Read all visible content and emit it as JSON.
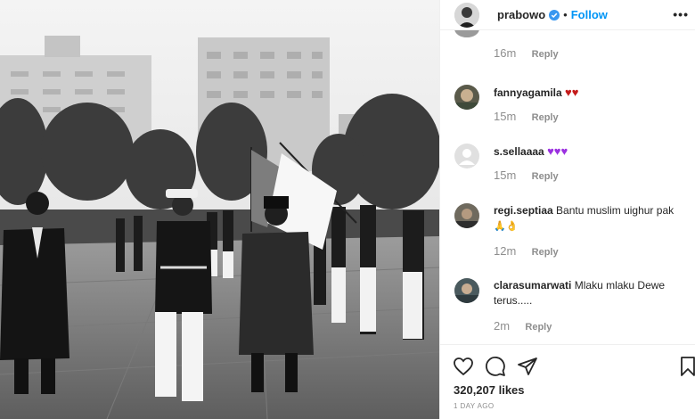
{
  "header": {
    "username": "prabowo",
    "separator": "•",
    "follow_label": "Follow",
    "more_label": "•••"
  },
  "comments": [
    {
      "username": "",
      "text": "",
      "time": "16m",
      "reply_label": "Reply",
      "avatar_icon": "avatar-photo"
    },
    {
      "username": "fannyagamila",
      "text": "",
      "emoji": "♥♥",
      "time": "15m",
      "reply_label": "Reply",
      "avatar_icon": "avatar-photo"
    },
    {
      "username": "s.sellaaaa",
      "text": "",
      "emoji": "♥♥♥",
      "time": "15m",
      "reply_label": "Reply",
      "avatar_icon": "default-avatar-icon"
    },
    {
      "username": "regi.septiaa",
      "text": "Bantu muslim uighur pak",
      "emoji": "🙏👌",
      "time": "12m",
      "reply_label": "Reply",
      "avatar_icon": "avatar-photo"
    },
    {
      "username": "clarasumarwati",
      "text": "Mlaku mlaku Dewe terus.....",
      "time": "2m",
      "reply_label": "Reply",
      "avatar_icon": "avatar-photo"
    }
  ],
  "actions": {
    "likes": "320,207 likes",
    "posted": "1 DAY AGO"
  },
  "colors": {
    "follow": "#0095f6",
    "verified": "#3897f0",
    "meta": "#8e8e8e",
    "heart": "#c41a1a",
    "purple_heart": "#9b30e0"
  }
}
